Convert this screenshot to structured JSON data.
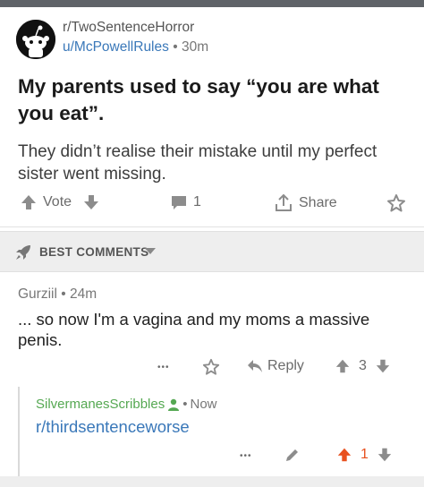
{
  "post": {
    "subreddit": "r/TwoSentenceHorror",
    "author": "u/McPowellRules",
    "separator": "•",
    "time": "30m",
    "title": "My parents used to say “you are what you eat”.",
    "body": "They didn’t realise their mistake until my perfect sister went missing.",
    "vote_label": "Vote",
    "comment_count": "1",
    "share_label": "Share"
  },
  "best_comments": {
    "label": "BEST COMMENTS"
  },
  "comment": {
    "author": "Gurziil",
    "separator": "•",
    "time": "24m",
    "body": "... so now I'm a vagina and my moms a massive penis.",
    "more": "•••",
    "reply_label": "Reply",
    "score": "3"
  },
  "reply": {
    "author": "SilvermanesScribbles",
    "separator": "•",
    "time": "Now",
    "body": "r/thirdsentenceworse",
    "more": "•••",
    "score": "1"
  },
  "colors": {
    "link_blue": "#3a78b9",
    "op_green": "#55a852",
    "upvote_orange": "#e8511f",
    "icon_gray": "#8c8c8c"
  },
  "icons": {
    "subreddit_avatar": "snoo-icon",
    "upvote": "arrow-up-icon",
    "downvote": "arrow-down-icon",
    "comments": "comment-bubble-icon",
    "share": "share-icon",
    "save": "star-icon",
    "best": "rocket-icon",
    "dropdown": "caret-down-icon",
    "reply": "reply-arrow-icon",
    "op": "person-icon",
    "edit": "pencil-icon"
  }
}
